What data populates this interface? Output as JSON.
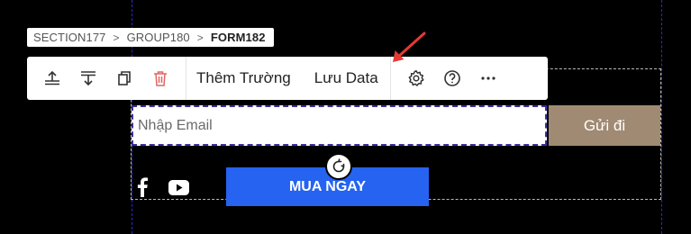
{
  "breadcrumb": {
    "items": [
      "SECTION177",
      "GROUP180",
      "FORM182"
    ],
    "separator": ">"
  },
  "toolbar": {
    "icons": [
      "move-up-icon",
      "move-down-icon",
      "duplicate-icon",
      "delete-icon"
    ],
    "add_field_label": "Thêm Trường",
    "save_data_label": "Lưu Data",
    "extra_icons": [
      "gear-icon",
      "help-icon",
      "more-icon"
    ]
  },
  "form": {
    "email_placeholder": "Nhập Email",
    "submit_label": "Gửi đi"
  },
  "cta": {
    "buy_label": "MUA NGAY"
  },
  "social": [
    "facebook-icon",
    "youtube-icon"
  ],
  "colors": {
    "background": "#000000",
    "submit_button": "#a08a73",
    "buy_button": "#2563f0",
    "delete_icon": "#e06666",
    "annotation_arrow": "#e53935",
    "selection_outline": "#3a2f9a"
  }
}
